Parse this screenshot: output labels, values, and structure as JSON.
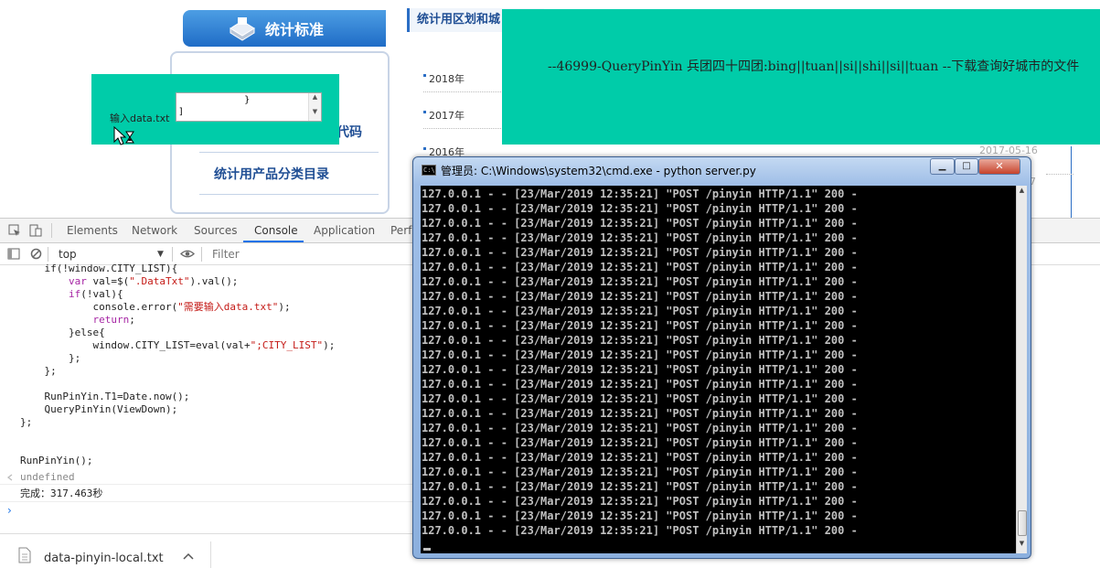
{
  "website": {
    "banner_title": "统计标准",
    "side_links": [
      "代码",
      "统计用产品分类目录"
    ],
    "area_header": "统计用区划和城",
    "years": [
      "2018年",
      "2017年",
      "2016年"
    ],
    "date_2016": "2017-05-16",
    "right_stub": "7"
  },
  "input_overlay": {
    "label": "输入data.txt",
    "textarea_value": "            }\n]"
  },
  "message_overlay": {
    "text": "--46999-QueryPinYin 兵团四十四团:bing||tuan||si||shi||si||tuan --下载查询好城市的文件"
  },
  "devtools": {
    "tabs": [
      "Elements",
      "Network",
      "Sources",
      "Console",
      "Application",
      "Perfo"
    ],
    "active_tab": "Console",
    "context": "top",
    "filter_placeholder": "Filter",
    "undefined_text": "undefined",
    "done_text": "完成：317.463秒",
    "prompt": "›"
  },
  "download_bar": {
    "file_name": "data-pinyin-local.txt"
  },
  "cmd": {
    "title": "管理员: C:\\Windows\\system32\\cmd.exe - python  server.py",
    "icon_text": "C:\\",
    "log_line": "127.0.0.1 - - [23/Mar/2019 12:35:21] \"POST /pinyin HTTP/1.1\" 200 -",
    "log_line_count": 24,
    "buttons": {
      "minimize": "▁",
      "maximize": "□",
      "close": "✕"
    }
  },
  "colors": {
    "overlay_green": "#00cca9",
    "console_accent": "#1a73e8"
  }
}
